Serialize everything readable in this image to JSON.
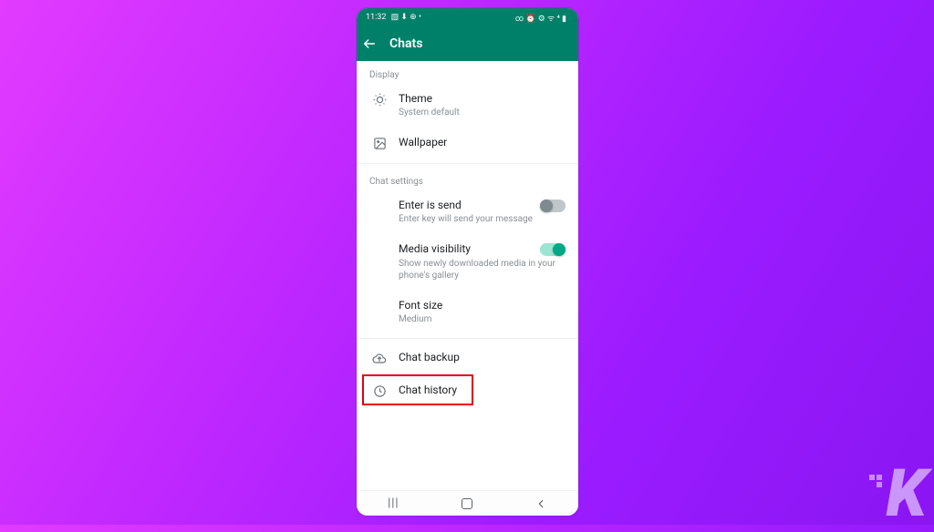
{
  "statusbar": {
    "time": "11:32",
    "left_icons": "▧ ⬇ ⊕ •",
    "right_icons": "∞ ⏰ ⚙ ᯤ ⁴ ▮"
  },
  "appbar": {
    "title": "Chats"
  },
  "sections": {
    "display_label": "Display",
    "chat_settings_label": "Chat settings"
  },
  "items": {
    "theme": {
      "title": "Theme",
      "subtitle": "System default"
    },
    "wallpaper": {
      "title": "Wallpaper"
    },
    "enter_is_send": {
      "title": "Enter is send",
      "subtitle": "Enter key will send your message",
      "enabled": false
    },
    "media_visibility": {
      "title": "Media visibility",
      "subtitle": "Show newly downloaded media in your phone's gallery",
      "enabled": true
    },
    "font_size": {
      "title": "Font size",
      "subtitle": "Medium"
    },
    "chat_backup": {
      "title": "Chat backup"
    },
    "chat_history": {
      "title": "Chat history"
    }
  },
  "watermark": "K"
}
